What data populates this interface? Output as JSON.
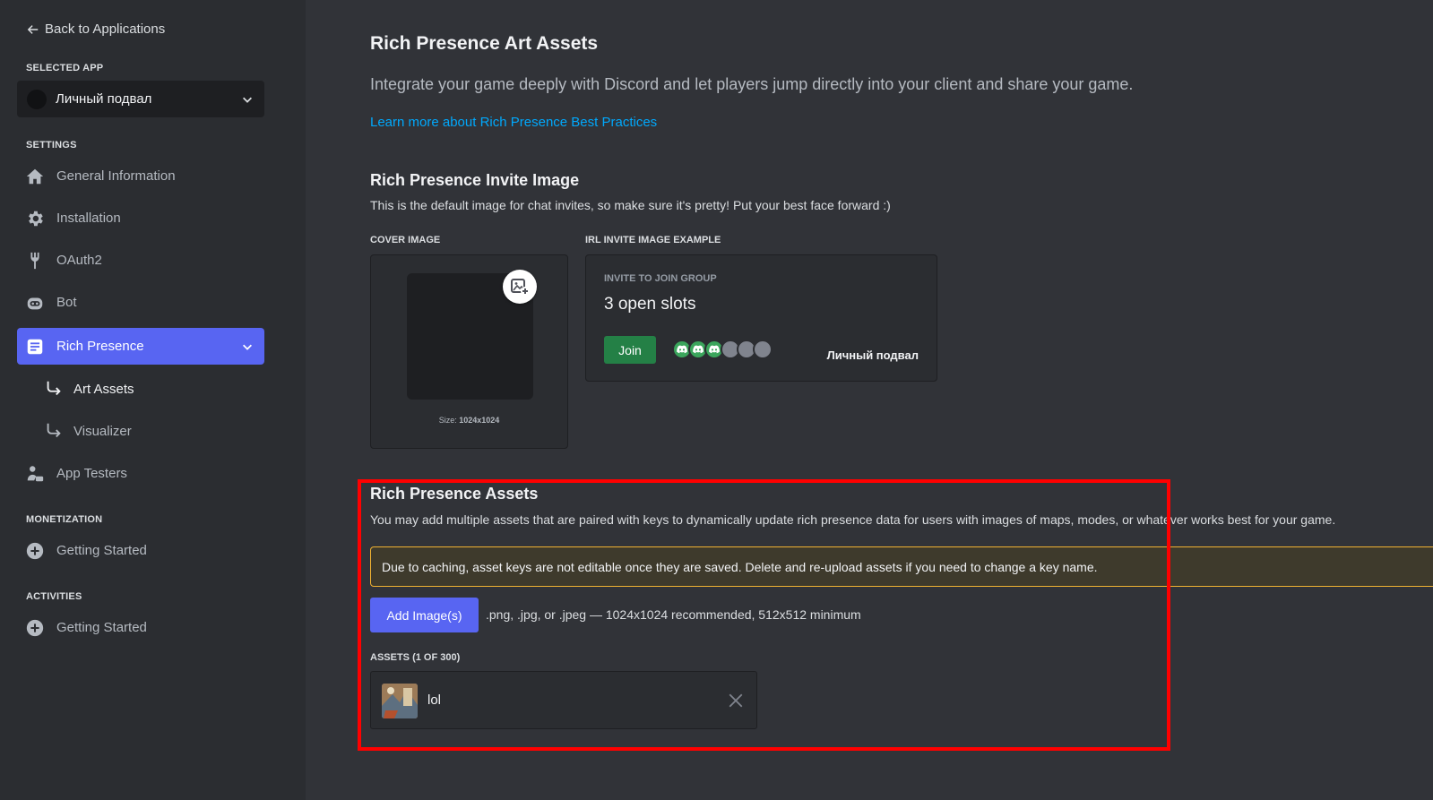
{
  "sidebar": {
    "back_label": "Back to Applications",
    "selected_app_heading": "SELECTED APP",
    "selected_app_name": "Личный подвал",
    "settings_heading": "SETTINGS",
    "items": [
      {
        "label": "General Information",
        "icon": "home-icon"
      },
      {
        "label": "Installation",
        "icon": "gear-icon"
      },
      {
        "label": "OAuth2",
        "icon": "wrench-icon"
      },
      {
        "label": "Bot",
        "icon": "robot-icon"
      },
      {
        "label": "Rich Presence",
        "icon": "document-icon",
        "active": true
      },
      {
        "label": "App Testers",
        "icon": "user-icon"
      }
    ],
    "sub_items": [
      {
        "label": "Art Assets",
        "icon": "arrow-return-icon",
        "current": true
      },
      {
        "label": "Visualizer",
        "icon": "arrow-return-icon"
      }
    ],
    "monetization_heading": "MONETIZATION",
    "monetization_item": "Getting Started",
    "activities_heading": "ACTIVITIES",
    "activities_item": "Getting Started"
  },
  "main": {
    "title": "Rich Presence Art Assets",
    "lead": "Integrate your game deeply with Discord and let players jump directly into your client and share your game.",
    "learn_link": "Learn more about Rich Presence Best Practices",
    "invite": {
      "title": "Rich Presence Invite Image",
      "description": "This is the default image for chat invites, so make sure it's pretty! Put your best face forward :)",
      "cover_label": "COVER IMAGE",
      "cover_size_prefix": "Size:",
      "cover_size_value": "1024x1024",
      "example_label": "IRL INVITE IMAGE EXAMPLE",
      "example_heading": "INVITE TO JOIN GROUP",
      "example_slots": "3 open slots",
      "join_label": "Join",
      "example_app_name": "Личный подвал"
    },
    "assets": {
      "title": "Rich Presence Assets",
      "description": "You may add multiple assets that are paired with keys to dynamically update rich presence data for users with images of maps, modes, or whatever works best for your game.",
      "notice": "Due to caching, asset keys are not editable once they are saved. Delete and re-upload assets if you need to change a key name.",
      "add_button": "Add Image(s)",
      "formats": ".png, .jpg, or .jpeg — 1024x1024 recommended, 512x512 minimum",
      "list_label": "ASSETS (1 OF 300)",
      "items": [
        {
          "name": "lol"
        }
      ]
    }
  },
  "colors": {
    "accent": "#5865f2",
    "join": "#248046",
    "link": "#00a8fc",
    "warning_border": "#f0b232",
    "highlight": "#ff0000"
  }
}
